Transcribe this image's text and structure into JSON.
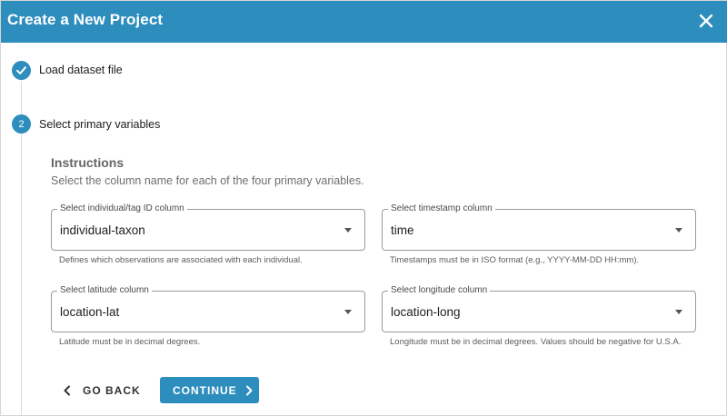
{
  "dialog": {
    "title": "Create a New Project",
    "close_icon": "close-icon"
  },
  "steps": [
    {
      "number": "1",
      "label": "Load dataset file",
      "status": "complete",
      "icon": "check-icon"
    },
    {
      "number": "2",
      "label": "Select primary variables",
      "status": "active"
    }
  ],
  "instructions": {
    "title": "Instructions",
    "text": "Select the column name for each of the four primary variables."
  },
  "fields": {
    "id_column": {
      "label": "Select individual/tag ID column",
      "value": "individual-taxon",
      "helper": "Defines which observations are associated with each individual."
    },
    "timestamp_column": {
      "label": "Select timestamp column",
      "value": "time",
      "helper": "Timestamps must be in ISO format (e.g., YYYY-MM-DD HH:mm)."
    },
    "latitude_column": {
      "label": "Select latitude column",
      "value": "location-lat",
      "helper": "Latitude must be in decimal degrees."
    },
    "longitude_column": {
      "label": "Select longitude column",
      "value": "location-long",
      "helper": "Longitude must be in decimal degrees. Values should be negative for U.S.A."
    }
  },
  "actions": {
    "back_label": "GO BACK",
    "continue_label": "CONTINUE"
  },
  "colors": {
    "primary": "#2d8dbd",
    "header_text": "#ffffff"
  }
}
